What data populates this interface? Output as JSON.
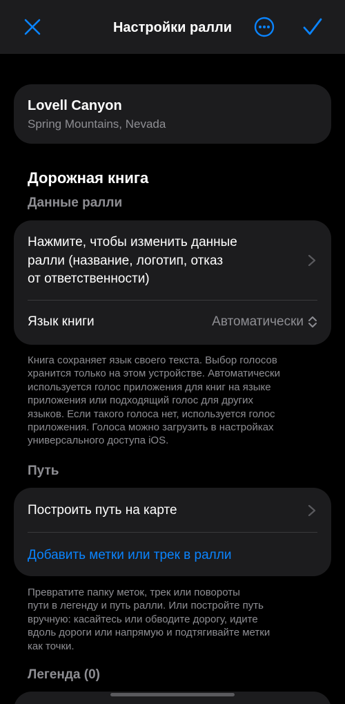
{
  "navbar": {
    "title": "Настройки ралли",
    "close_icon": "close-icon",
    "more_icon": "more-circle-icon",
    "done_icon": "checkmark-icon"
  },
  "location": {
    "name": "Lovell Canyon",
    "region": "Spring Mountains, Nevada"
  },
  "roadbook": {
    "title": "Дорожная книга",
    "subtitle": "Данные ралли",
    "edit_line1": "Нажмите, чтобы изменить данные",
    "edit_line2": "ралли (название, логотип, отказ",
    "edit_line3": "от ответственности)",
    "language_label": "Язык книги",
    "language_value": "Автоматически",
    "note_lines": [
      "Книга сохраняет язык своего текста. Выбор голосов",
      "хранится только на этом устройстве. Автоматически",
      "используется голос приложения для книг на языке",
      "приложения или подходящий голос для других",
      "языков. Если такого голоса нет, используется голос",
      "приложения. Голоса можно загрузить в настройках",
      "универсального доступа iOS."
    ]
  },
  "path": {
    "title": "Путь",
    "build_label": "Построить путь на карте",
    "add_label": "Добавить метки или трек в ралли",
    "note_lines": [
      "Превратите папку меток, трек или повороты",
      "пути в легенду и путь ралли. Или постройте путь",
      "вручную: касайтесь или обводите дорогу, идите",
      "вдоль дороги или напрямую и подтягивайте метки",
      "как точки."
    ]
  },
  "legend": {
    "title": "Легенда (0)"
  },
  "colors": {
    "accent": "#0a84ff",
    "background": "#000000",
    "card": "#1c1c1e",
    "secondary_text": "#8e8e93"
  }
}
